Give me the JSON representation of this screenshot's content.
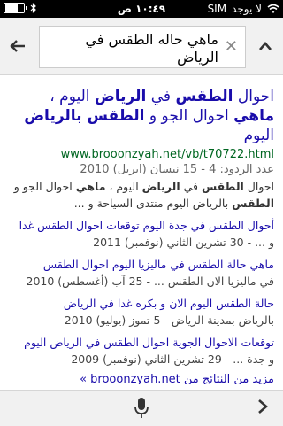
{
  "status": {
    "carrier": "SIM",
    "signal_text": "لا يوجد",
    "time": "١٠:٤٩ ص",
    "battery_level": 0.7
  },
  "search": {
    "query": "ماهي حاله الطقس في الرياض",
    "back_icon": "left-arrow",
    "clear_icon": "close",
    "collapse_icon": "chevron-up"
  },
  "results": {
    "main": {
      "title_part1": "احوال ",
      "title_bold1": "الطقس",
      "title_part2": " في ",
      "title_bold2": "الرياض",
      "title_part3": " اليوم ، ",
      "title_bold3": "ماهي",
      "title_part4": " احوال الجو و ",
      "title_bold4": "الطقس بالرياض",
      "title_part5": " اليوم",
      "url": "www.brooonzyah.net/vb/t70722.html",
      "meta": "عدد الردود: 4 - 15 نيسان (ابريل) 2010",
      "snippet_part1": "احوال ",
      "snippet_bold1": "الطقس",
      "snippet_part2": " في ",
      "snippet_bold2": "الرياض",
      "snippet_part3": " اليوم ، ",
      "snippet_bold3": "ماهي",
      "snippet_part4": " احوال الجو و ",
      "snippet_bold4": "الطقس",
      "snippet_part5": " بالرياض اليوم منتدى السياحة و ..."
    },
    "subresults": [
      {
        "link": "أحوال الطقس في جدة اليوم توقعات احوال الطقس غدا",
        "date": "و ... - 30 تشرين الثاني (نوفمبر) 2011"
      },
      {
        "link": "ماهي حالة الطقس في ماليزيا اليوم احوال الطقس",
        "date": "في ماليزيا الان الطقس ... - 25 آب (أغسطس) 2010"
      },
      {
        "link": "حالة الطقس اليوم الان و بكره غدا في الرياض",
        "date": "بالرياض بمدينة الرياض - 5 تموز (يوليو) 2010"
      },
      {
        "link": "توقعات الاحوال الجوية احوال الطقس في الرياض اليوم",
        "date": "و جدة ... - 29 تشرين الثاني (نوفمبر) 2009"
      }
    ],
    "more": "مزيد من النتائج من brooonzyah.net »"
  },
  "bottom": {
    "mic_icon": "microphone",
    "forward_icon": "chevron-right"
  }
}
